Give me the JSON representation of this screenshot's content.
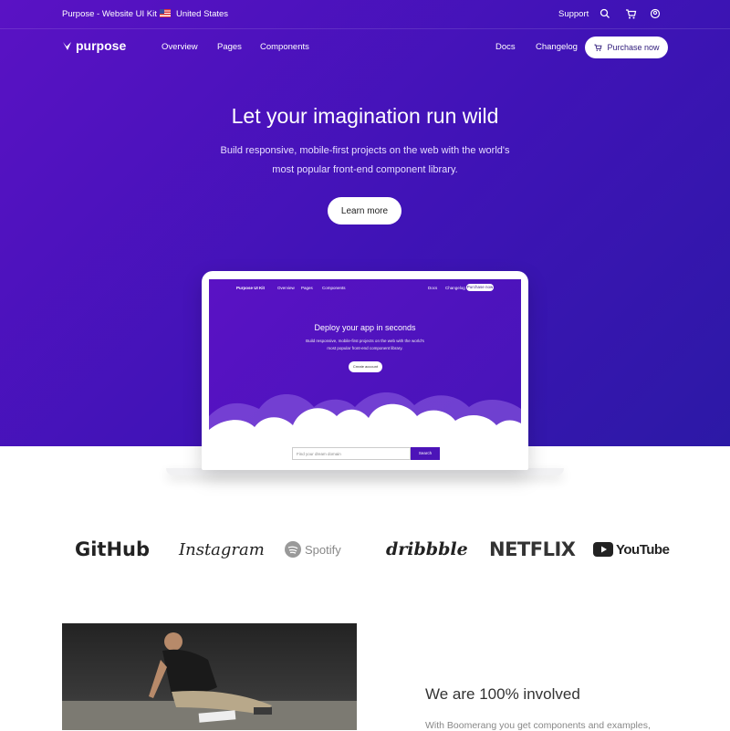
{
  "topbar": {
    "kit": "Purpose - Website UI Kit",
    "country": "United States",
    "support": "Support",
    "icons": [
      "search-icon",
      "cart-icon",
      "user-icon"
    ]
  },
  "nav": {
    "logo": "purpose",
    "links": [
      "Overview",
      "Pages",
      "Components"
    ],
    "right_links": [
      "Docs",
      "Changelog"
    ],
    "purchase": "Purchase now"
  },
  "hero": {
    "title": "Let your imagination run wild",
    "subtitle_line1": "Build responsive, mobile-first projects on the web with the world's",
    "subtitle_line2": "most popular front-end component library.",
    "cta": "Learn more"
  },
  "mockup": {
    "brand": "Purpose UI Kit",
    "links": [
      "Overview",
      "Pages",
      "Components"
    ],
    "right": [
      "Docs",
      "Changelog"
    ],
    "purchase": "Purchase now",
    "title": "Deploy your app in seconds",
    "sub1": "Build responsive, mobile-first projects on the web with the world's",
    "sub2": "most popular front-end component library.",
    "cta": "Create account",
    "search_placeholder": "Find your dream domain",
    "search_btn": "Search"
  },
  "brands": [
    "GitHub",
    "Instagram",
    "Spotify",
    "dribbble",
    "NETFLIX",
    "YouTube"
  ],
  "about": {
    "title": "We are 100% involved",
    "text": "With Boomerang you get components and examples,"
  },
  "colors": {
    "primary": "#4a14bf",
    "white": "#ffffff"
  }
}
